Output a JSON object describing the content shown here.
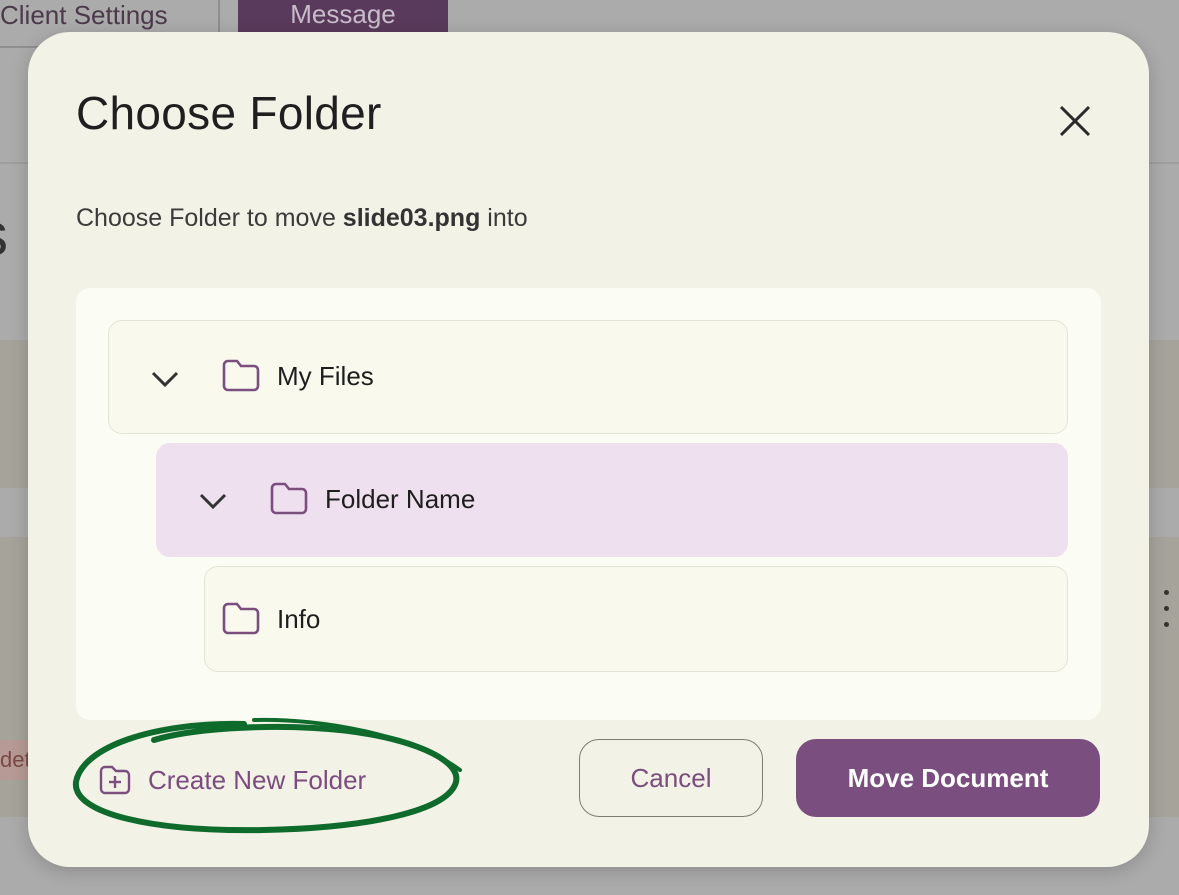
{
  "background": {
    "tabs": [
      {
        "label": "Client Settings"
      },
      {
        "label": "Message"
      }
    ],
    "det_badge": "det"
  },
  "dialog": {
    "title": "Choose Folder",
    "subtitle_prefix": "Choose Folder to move ",
    "file_name": "slide03.png",
    "subtitle_suffix": " into",
    "tree": [
      {
        "label": "My Files",
        "expanded": true,
        "selected": false,
        "icon": "folder-icon"
      },
      {
        "label": "Folder Name",
        "expanded": true,
        "selected": true,
        "icon": "folder-icon"
      },
      {
        "label": "Info",
        "expanded": false,
        "selected": false,
        "icon": "folder-icon"
      }
    ],
    "create_folder_label": "Create New Folder",
    "cancel_label": "Cancel",
    "move_label": "Move Document"
  },
  "colors": {
    "accent": "#7b4e80",
    "selected_row": "#efe0f0",
    "annotation": "#0f6b2c"
  }
}
